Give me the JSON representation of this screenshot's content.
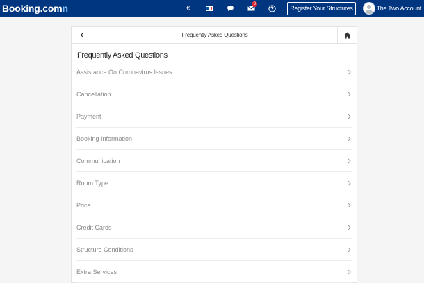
{
  "topbar": {
    "logo_main": "Booking.com",
    "logo_accent": "n",
    "currency": "€",
    "flag_colors": [
      "#0055a4",
      "#ffffff",
      "#ef4135"
    ],
    "messages_icon": "chat-bubble-icon",
    "notifications_icon": "envelope-icon",
    "notifications_count": "3",
    "help_icon": "question-circle-icon",
    "register_label": "Register Your Structures",
    "account_name": "The Two Account"
  },
  "page": {
    "header_title": "Frequently Asked Questions",
    "section_title": "Frequently Asked Questions",
    "faq_items": [
      {
        "label": "Assistance On Coronavirus Issues"
      },
      {
        "label": "Cancellation"
      },
      {
        "label": "Payment"
      },
      {
        "label": "Booking Information"
      },
      {
        "label": "Communication"
      },
      {
        "label": "Room Type"
      },
      {
        "label": "Price"
      },
      {
        "label": "Credit Cards"
      },
      {
        "label": "Structure Conditions"
      },
      {
        "label": "Extra Services"
      }
    ]
  },
  "colors": {
    "brand": "#003580",
    "badge": "#e3262e",
    "text_muted": "#8a8a8a"
  }
}
